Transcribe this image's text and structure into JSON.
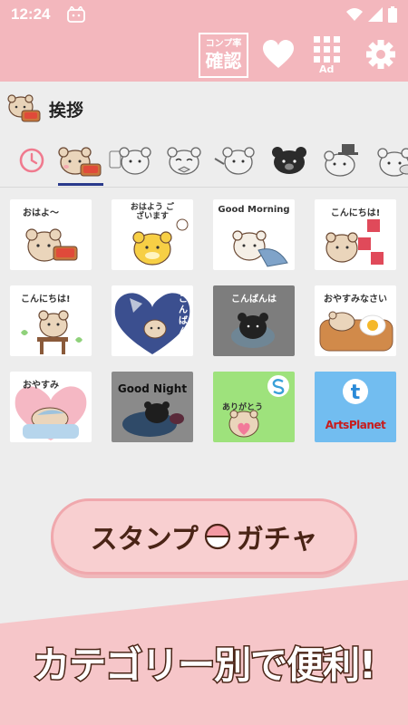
{
  "status_bar": {
    "time": "12:24",
    "icons": [
      "cat-face-icon",
      "wifi-icon",
      "signal-icon",
      "battery-icon"
    ]
  },
  "app_bar": {
    "completion_badge": {
      "line1": "コンプ率",
      "line2": "確認"
    },
    "ad_label": "Ad",
    "actions": [
      "heart-icon",
      "grid-ad-icon",
      "gear-icon"
    ]
  },
  "category": {
    "title": "挨拶"
  },
  "tabs": [
    {
      "name": "clock-icon",
      "active": false
    },
    {
      "name": "bear-beige",
      "active": true
    },
    {
      "name": "bear-gray-1",
      "active": false
    },
    {
      "name": "bear-gray-2",
      "active": false
    },
    {
      "name": "bear-gray-3",
      "active": false
    },
    {
      "name": "bear-black",
      "active": false
    },
    {
      "name": "bear-hat",
      "active": false
    },
    {
      "name": "bear-gray-4",
      "active": false
    }
  ],
  "stickers": [
    {
      "caption": "おはよ～",
      "kind": "sticker"
    },
    {
      "caption": "おはよう ございます",
      "kind": "sticker"
    },
    {
      "caption": "Good Morning",
      "kind": "sticker"
    },
    {
      "caption": "こんにちは!",
      "kind": "sticker"
    },
    {
      "caption": "こんにちは!",
      "kind": "sticker"
    },
    {
      "caption": "こんばんは",
      "kind": "sticker"
    },
    {
      "caption": "こんばんは",
      "kind": "sticker"
    },
    {
      "caption": "おやすみなさい",
      "kind": "sticker"
    },
    {
      "caption": "おやすみ",
      "kind": "sticker"
    },
    {
      "caption": "Good Night",
      "kind": "sticker"
    },
    {
      "caption": "ありがとう",
      "kind": "sticker"
    },
    {
      "caption": "ArtsPlanet",
      "kind": "sticker"
    }
  ],
  "gacha_button": {
    "left": "スタンプ",
    "right": "ガチャ"
  },
  "banner": {
    "text": "カテゴリー別で便利!"
  },
  "colors": {
    "header": "#f3b7bd",
    "gacha_fill": "#f8cfd0",
    "banner_pink": "#f6c6c9",
    "text_brown": "#4a2416",
    "tab_underline": "#2a3a8c"
  }
}
